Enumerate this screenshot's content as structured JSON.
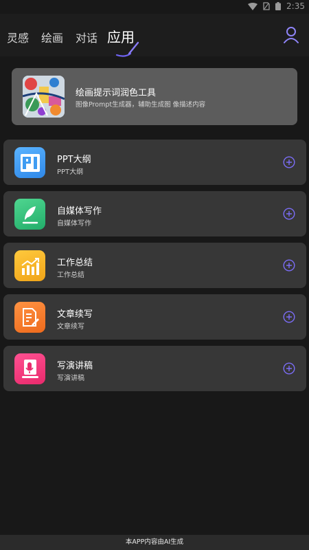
{
  "status": {
    "time": "2:35"
  },
  "nav": {
    "tabs": [
      {
        "label": "灵感"
      },
      {
        "label": "绘画"
      },
      {
        "label": "对话"
      },
      {
        "label": "应用"
      }
    ],
    "active_tab": "应用",
    "user_icon": "user-icon"
  },
  "featured": {
    "title": "绘画提示词润色工具",
    "subtitle": "图像Prompt生成器，辅助生成图 像描述内容"
  },
  "tools": [
    {
      "title": "PPT大纲",
      "subtitle": "PPT大纲",
      "icon": "ppt-icon",
      "color": "#3f9cf2"
    },
    {
      "title": "自媒体写作",
      "subtitle": "自媒体写作",
      "icon": "feather-icon",
      "color": "#2fbf79"
    },
    {
      "title": "工作总结",
      "subtitle": "工作总结",
      "icon": "chart-icon",
      "color": "#f5b324"
    },
    {
      "title": "文章续写",
      "subtitle": "文章续写",
      "icon": "document-edit-icon",
      "color": "#f47a2a"
    },
    {
      "title": "写演讲稿",
      "subtitle": "写演讲稿",
      "icon": "microphone-icon",
      "color": "#f0397a"
    }
  ],
  "footer": {
    "text": "本APP内容由AI生成"
  },
  "colors": {
    "background": "#181818",
    "card": "#373737",
    "accent": "#7b6df6"
  }
}
